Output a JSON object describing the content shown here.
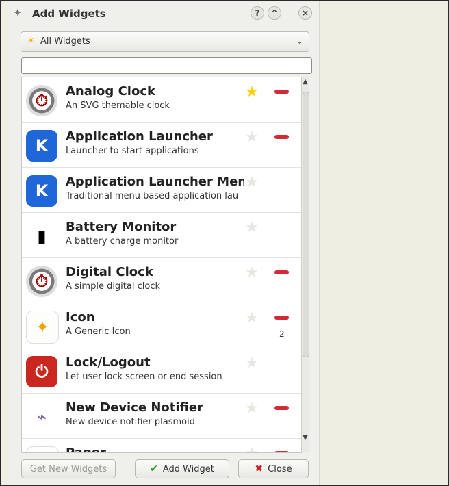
{
  "panel": {
    "title": "Add Widgets",
    "title_icon": "wand-icon",
    "help_label": "?",
    "collapse_label": "^",
    "close_label": "×",
    "filter": {
      "selected": "All Widgets",
      "icon": "sun-icon"
    },
    "search": {
      "value": "",
      "placeholder": ""
    },
    "widgets": [
      {
        "name": "Analog Clock",
        "description": "An SVG themable clock",
        "icon": "analog-clock-icon",
        "favorite": true,
        "removable": true
      },
      {
        "name": "Application Launcher",
        "description": "Launcher to start applications",
        "icon": "kde-launcher-icon",
        "favorite": false,
        "removable": true
      },
      {
        "name": "Application Launcher Menu",
        "description": "Traditional menu based application launcher",
        "icon": "kde-launcher-icon",
        "favorite": false,
        "removable": false
      },
      {
        "name": "Battery Monitor",
        "description": "A battery charge monitor",
        "icon": "battery-icon",
        "favorite": false,
        "removable": false
      },
      {
        "name": "Digital Clock",
        "description": "A simple digital clock",
        "icon": "digital-clock-icon",
        "favorite": false,
        "removable": true
      },
      {
        "name": "Icon",
        "description": "A Generic Icon",
        "icon": "generic-icon",
        "favorite": false,
        "removable": true,
        "count": "2"
      },
      {
        "name": "Lock/Logout",
        "description": "Let user lock screen or end session",
        "icon": "power-icon",
        "favorite": false,
        "removable": false
      },
      {
        "name": "New Device Notifier",
        "description": "New device notifier plasmoid",
        "icon": "usb-icon",
        "favorite": false,
        "removable": true
      },
      {
        "name": "Pager",
        "description": "",
        "icon": "pager-icon",
        "favorite": false,
        "removable": true
      }
    ],
    "buttons": {
      "get_new": "Get New Widgets",
      "add": "Add Widget",
      "close": "Close"
    }
  }
}
